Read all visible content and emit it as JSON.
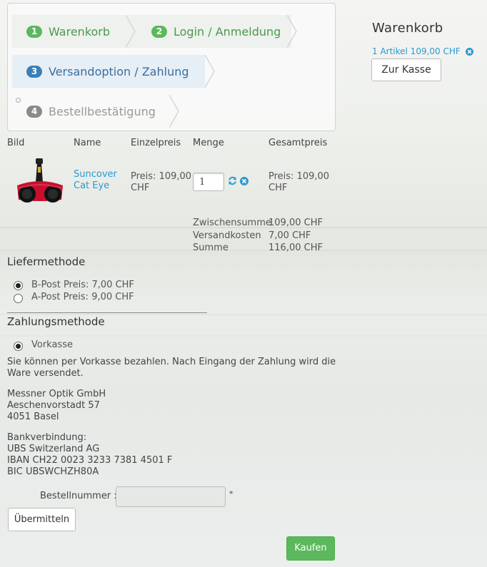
{
  "steps": [
    {
      "num": "1",
      "label": "Warenkorb"
    },
    {
      "num": "2",
      "label": "Login / Anmeldung"
    },
    {
      "num": "3",
      "label": "Versandoption / Zahlung"
    },
    {
      "num": "4",
      "label": "Bestellbestätigung"
    }
  ],
  "table": {
    "headers": [
      "Bild",
      "Name",
      "Einzelpreis",
      "Menge",
      "Gesamtpreis"
    ],
    "row": {
      "name_line1": "Suncover",
      "name_line2": "Cat Eye",
      "unit_price_line1": "Preis: 109,00",
      "unit_price_line2": "CHF",
      "quantity": "1",
      "total_line1": "Preis: 109,00",
      "total_line2": "CHF"
    },
    "summary": [
      {
        "label": "Zwischensumme",
        "value": "109,00 CHF"
      },
      {
        "label": "Versandkosten",
        "value": "7,00 CHF"
      },
      {
        "label": "Summe",
        "value": "116,00 CHF"
      }
    ]
  },
  "delivery": {
    "title": "Liefermethode",
    "options": [
      "B-Post Preis: 7,00 CHF",
      "A-Post Preis: 9,00 CHF"
    ],
    "selected": "B-Post Preis: 7,00 CHF"
  },
  "payment": {
    "title": "Zahlungsmethode",
    "option": "Vorkasse",
    "description_line1": "Sie können per Vorkasse bezahlen. Nach Eingang der Zahlung wird die",
    "description_line2": "Ware versendet.",
    "address": [
      "Messner Optik GmbH",
      "Aeschenvorstadt 57",
      "4051 Basel"
    ],
    "bank": [
      "Bankverbindung:",
      "UBS Switzerland AG",
      "IBAN CH22 0023 3233 7381 4501 F",
      "BIC UBSWCHZH80A"
    ],
    "order_label": "Bestellnummer :",
    "order_required": "*",
    "submit_label": "Übermitteln"
  },
  "buy_label": "Kaufen",
  "sidebar": {
    "title": "Warenkorb",
    "summary": "1 Artikel 109,00 CHF",
    "checkout_label": "Zur Kasse"
  },
  "colors": {
    "accent_green": "#5cb85c",
    "link_blue": "#2a9ad0",
    "step_blue": "#3a7fb8"
  },
  "icons": [
    "refresh-icon",
    "remove-icon",
    "product-image-cat-eye-sunglasses"
  ]
}
